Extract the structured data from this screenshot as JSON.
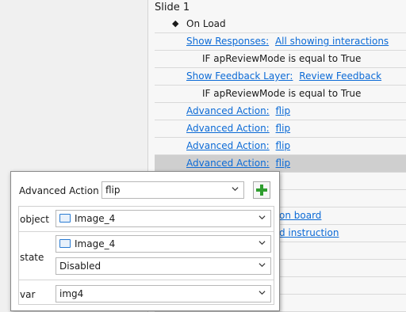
{
  "triggers": {
    "slide_title": "Slide 1",
    "on_load": "On Load",
    "rows": [
      {
        "action": "Show Responses:",
        "target": "All showing interactions"
      },
      {
        "condition": "IF apReviewMode is equal to True"
      },
      {
        "action": "Show Feedback Layer:",
        "target": "Review Feedback"
      },
      {
        "condition": "IF apReviewMode is equal to True"
      },
      {
        "action": "Advanced Action:",
        "target": "flip"
      },
      {
        "action": "Advanced Action:",
        "target": "flip"
      },
      {
        "action": "Advanced Action:",
        "target": "flip"
      },
      {
        "action": "Advanced Action:",
        "target": "flip"
      }
    ],
    "partial_rows": [
      "on board",
      "d instruction"
    ]
  },
  "popup": {
    "header_label": "Advanced Action",
    "action_value": "flip",
    "add_icon": "plus-icon",
    "object_label": "object",
    "object_value": "Image_4",
    "state_label": "state",
    "state_object_value": "Image_4",
    "state_value": "Disabled",
    "var_label": "var",
    "var_value": "img4"
  },
  "colors": {
    "link": "#0b6ad6",
    "add": "#2f9e2f",
    "selected_row": "#cfcfcf"
  }
}
